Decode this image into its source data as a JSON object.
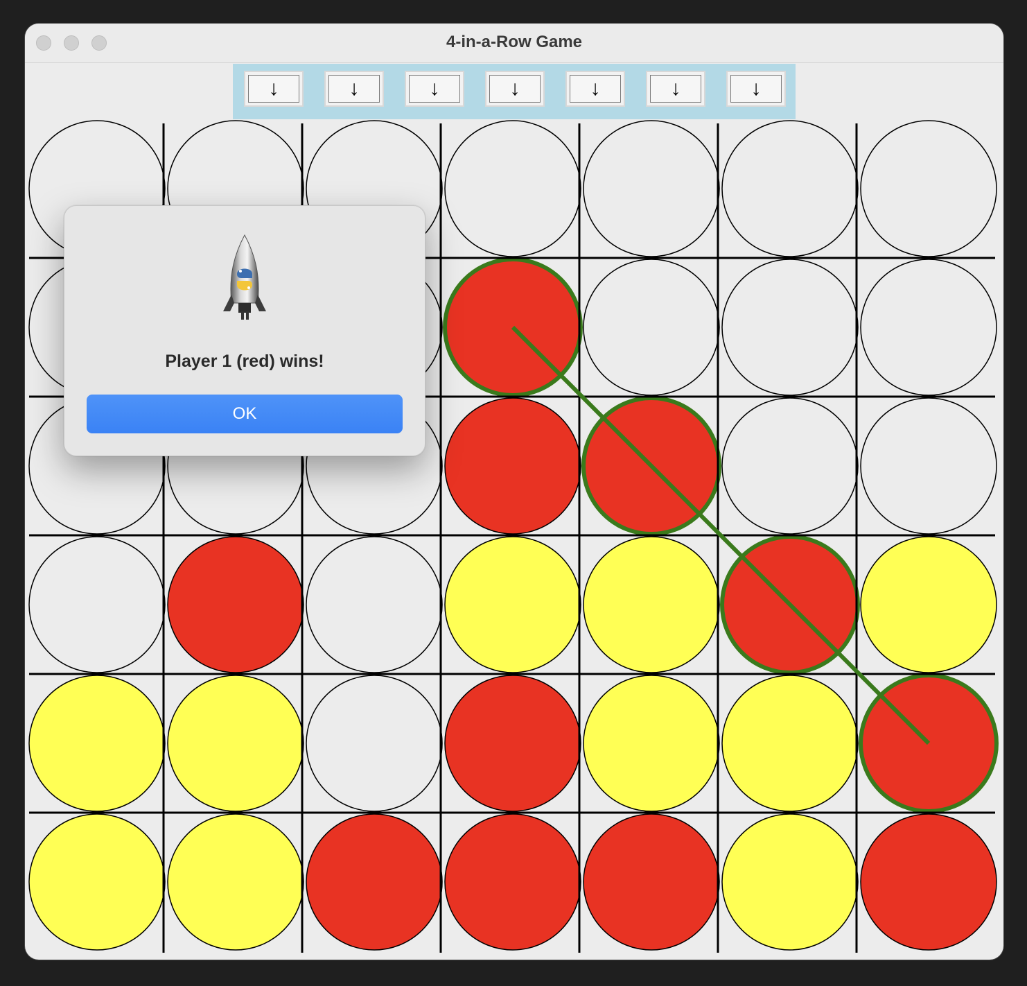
{
  "window": {
    "title": "4-in-a-Row Game"
  },
  "controls": {
    "drop_buttons": [
      "↓",
      "↓",
      "↓",
      "↓",
      "↓",
      "↓",
      "↓"
    ]
  },
  "board": {
    "columns": 7,
    "rows": 6,
    "cells": [
      [
        "empty",
        "empty",
        "empty",
        "empty",
        "empty",
        "empty",
        "empty"
      ],
      [
        "empty",
        "empty",
        "empty",
        "red",
        "empty",
        "empty",
        "empty"
      ],
      [
        "empty",
        "empty",
        "empty",
        "red",
        "red",
        "empty",
        "empty"
      ],
      [
        "empty",
        "red",
        "empty",
        "yellow",
        "yellow",
        "red",
        "yellow"
      ],
      [
        "yellow",
        "yellow",
        "empty",
        "red",
        "yellow",
        "yellow",
        "red"
      ],
      [
        "yellow",
        "yellow",
        "red",
        "red",
        "red",
        "yellow",
        "red"
      ]
    ],
    "winning_cells": [
      [
        1,
        3
      ],
      [
        2,
        4
      ],
      [
        3,
        5
      ],
      [
        4,
        6
      ]
    ],
    "colors": {
      "red": "#e83323",
      "yellow": "#ffff55",
      "empty": "#ececec",
      "win_line": "#3a7a1c",
      "grid": "#000000"
    }
  },
  "dialog": {
    "icon": "python-rocket-icon",
    "message": "Player 1 (red) wins!",
    "ok_label": "OK"
  }
}
